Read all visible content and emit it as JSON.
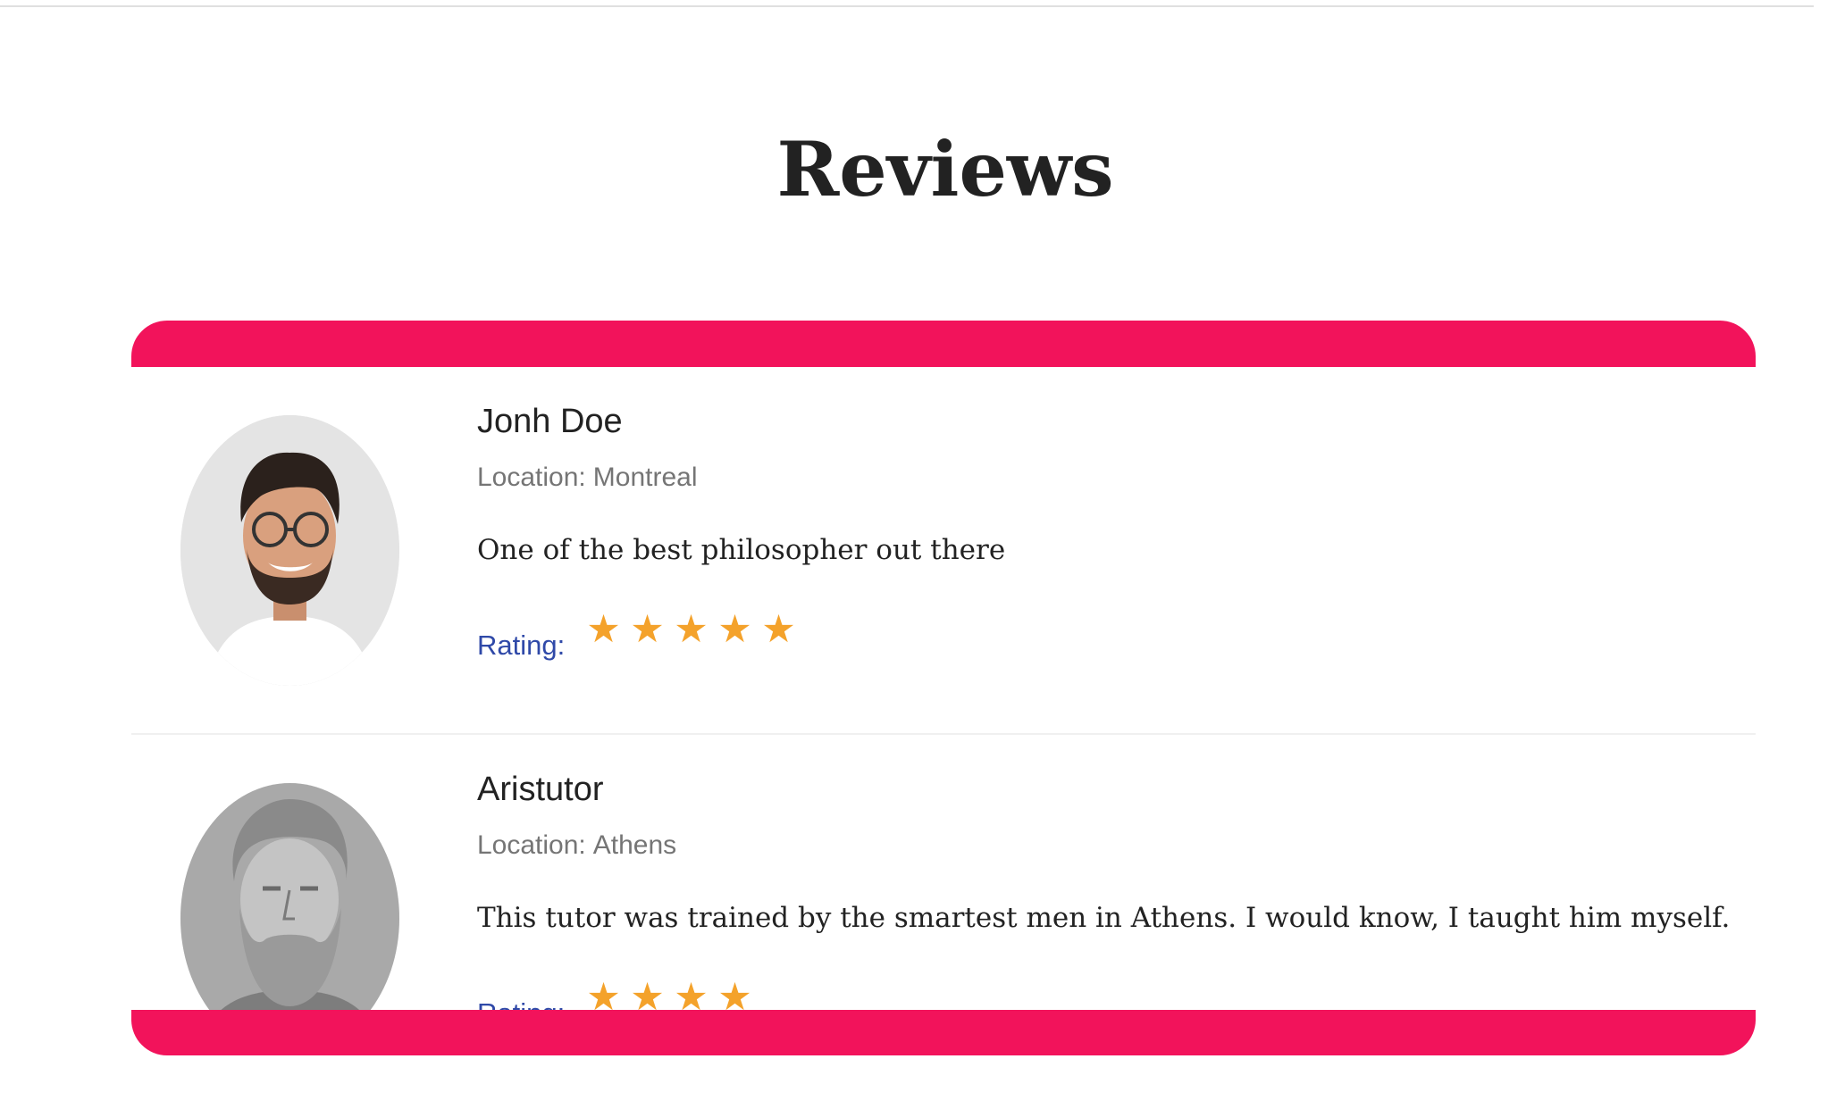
{
  "page": {
    "title": "Reviews"
  },
  "colors": {
    "accent": "#f2135b",
    "star": "#f4a22b",
    "rating_label": "#2f49a8"
  },
  "reviews": [
    {
      "name": "Jonh Doe",
      "location_label": "Location:",
      "location": "Montreal",
      "comment": "One of the best philosopher out there",
      "rating_label": "Rating:",
      "rating": 5,
      "avatar_icon": "person-photo"
    },
    {
      "name": "Aristutor",
      "location_label": "Location:",
      "location": "Athens",
      "comment": "This tutor was trained by the smartest men in Athens. I would know, I taught him myself.",
      "rating_label": "Rating:",
      "rating": 4,
      "avatar_icon": "statue-photo"
    }
  ]
}
